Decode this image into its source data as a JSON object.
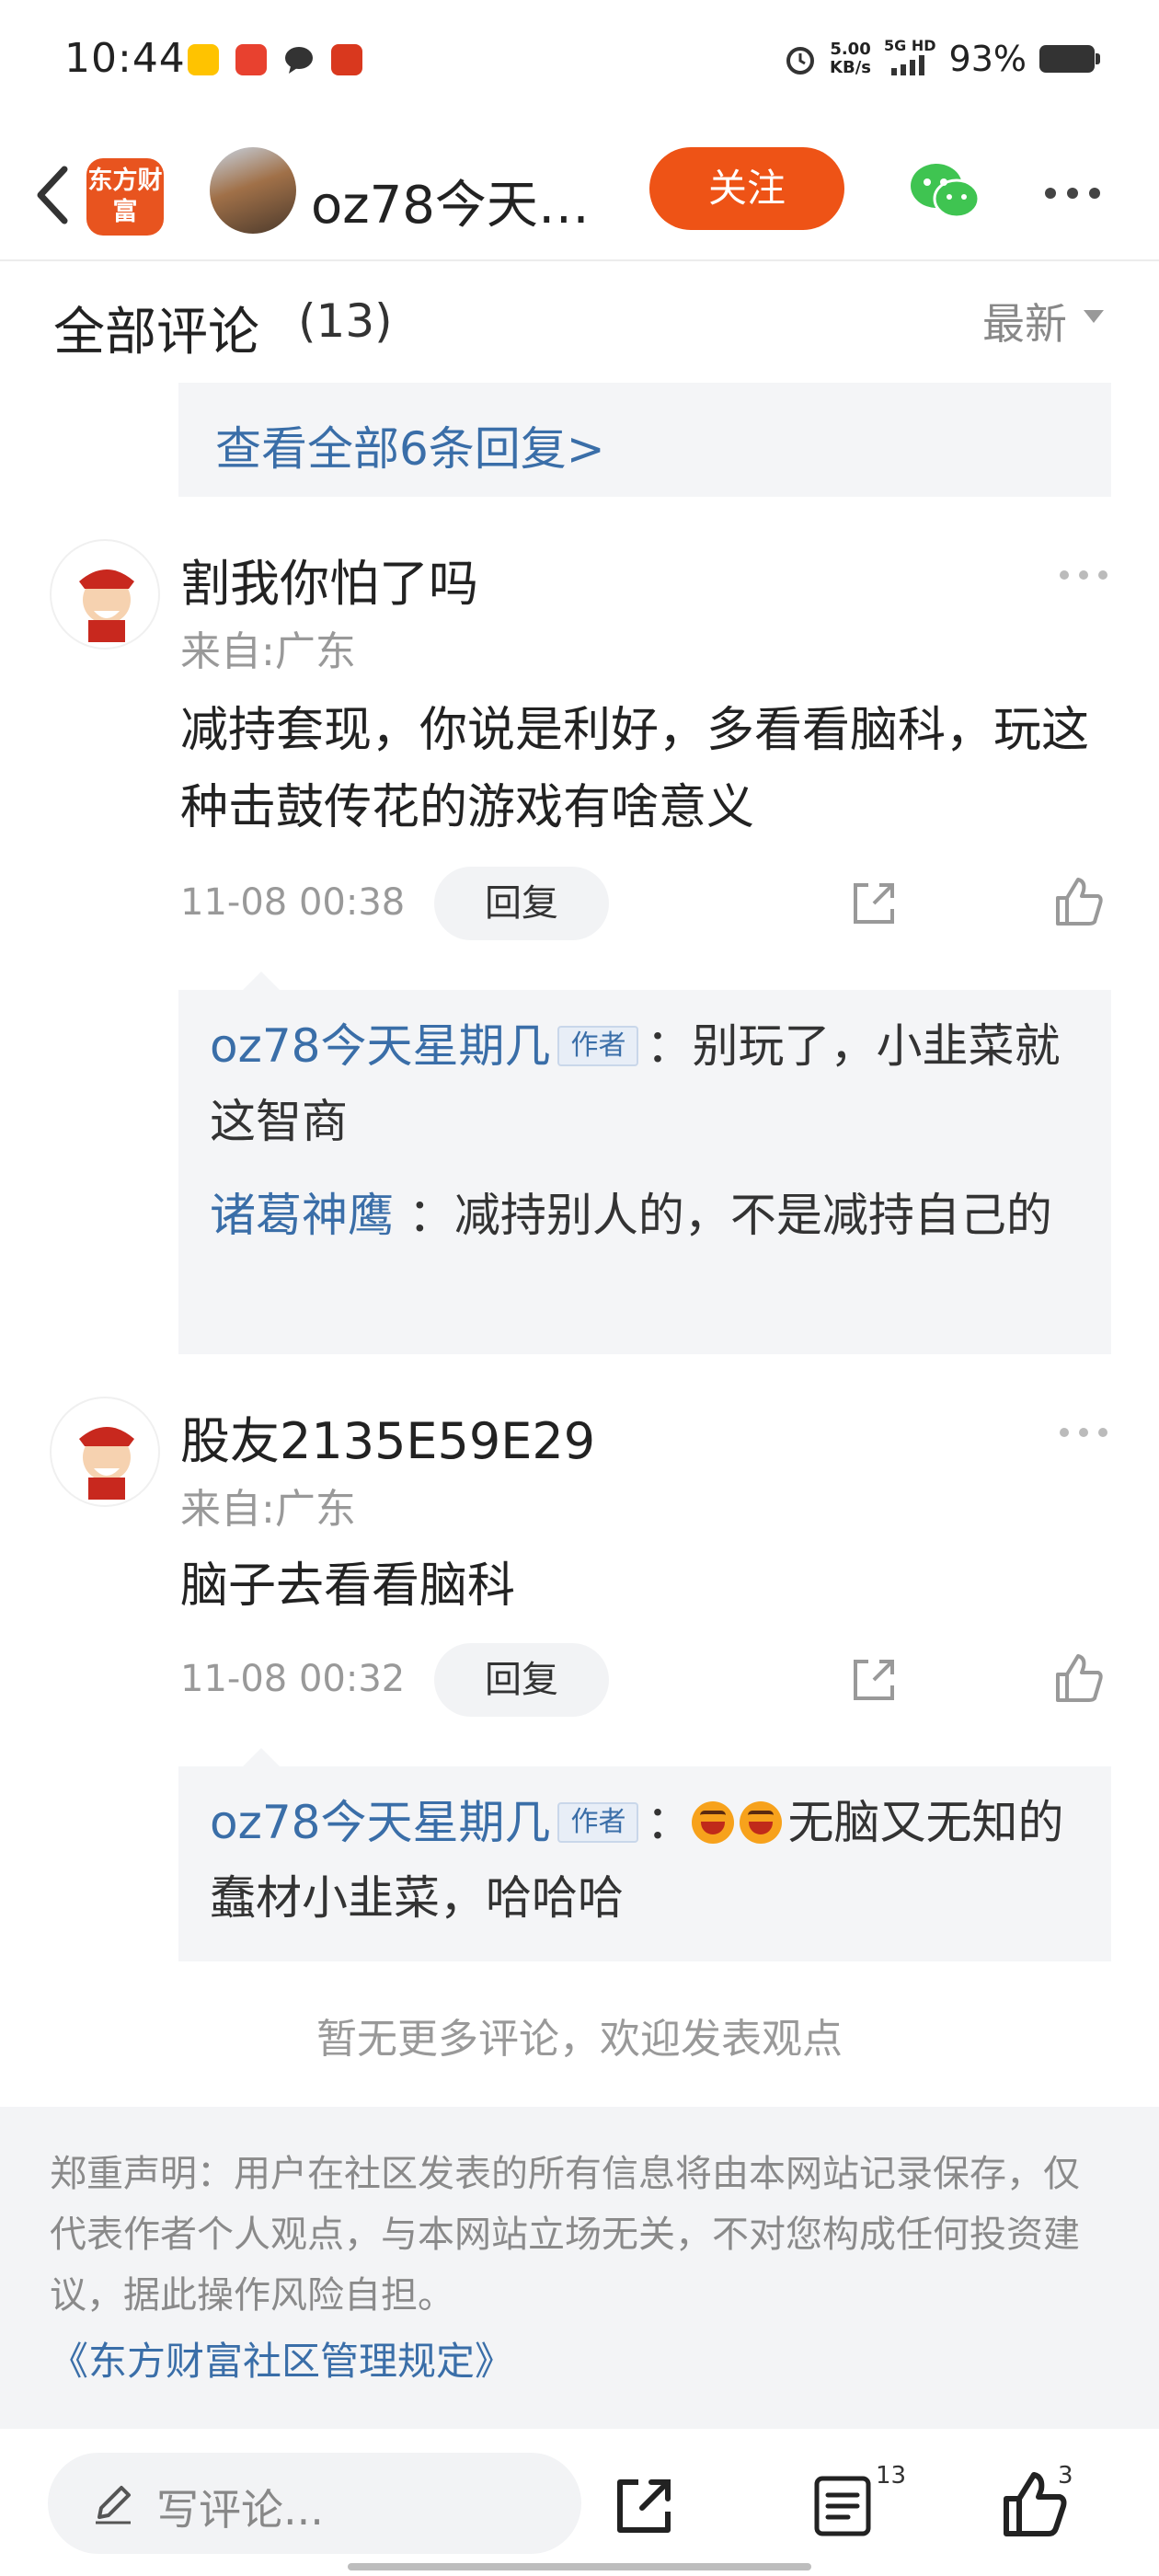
{
  "status_bar": {
    "time": "10:44",
    "network_speed_value": "5.00",
    "network_speed_unit": "KB/s",
    "signal": "5G HD",
    "battery_percent": "93%",
    "app_icons": [
      "meituan-icon",
      "app-red-icon",
      "chat-bubble-icon",
      "app-gift-icon"
    ]
  },
  "header": {
    "brand_logo_text": "东方财富",
    "author_name": "oz78今天…",
    "follow_label": "关注"
  },
  "comments_section": {
    "title": "全部评论",
    "count": "(13)",
    "sort_label": "最新",
    "view_all_replies": "查看全部6条回复>"
  },
  "comments": [
    {
      "username": "割我你怕了吗",
      "location": "来自:广东",
      "text": "减持套现，你说是利好，多看看脑科，玩这种击鼓传花的游戏有啥意义",
      "time": "11-08 00:38",
      "reply_label": "回复",
      "replies": [
        {
          "name": "oz78今天星期几",
          "tag": "作者",
          "text": "：别玩了，小韭菜就这智商"
        },
        {
          "name": "诸葛神鹰",
          "tag": "",
          "text": " ：减持别人的，不是减持自己的"
        }
      ]
    },
    {
      "username": "股友2135E59E29",
      "location": "来自:广东",
      "text": "脑子去看看脑科",
      "time": "11-08 00:32",
      "reply_label": "回复",
      "replies": [
        {
          "name": "oz78今天星期几",
          "tag": "作者",
          "prefix": "：",
          "text": "无脑又无知的蠢材小韭菜，哈哈哈"
        }
      ]
    }
  ],
  "no_more_text": "暂无更多评论，欢迎发表观点",
  "disclaimer": {
    "text": "郑重声明：用户在社区发表的所有信息将由本网站记录保存，仅代表作者个人观点，与本网站立场无关，不对您构成任何投资建议，据此操作风险自担。",
    "link": "《东方财富社区管理规定》"
  },
  "bottom_bar": {
    "comment_placeholder": "写评论...",
    "comments_count": "13",
    "likes_count": "3"
  },
  "colors": {
    "accent_orange": "#ee5316",
    "link_blue": "#3a6ea8",
    "reply_bg": "#f4f5f7"
  }
}
